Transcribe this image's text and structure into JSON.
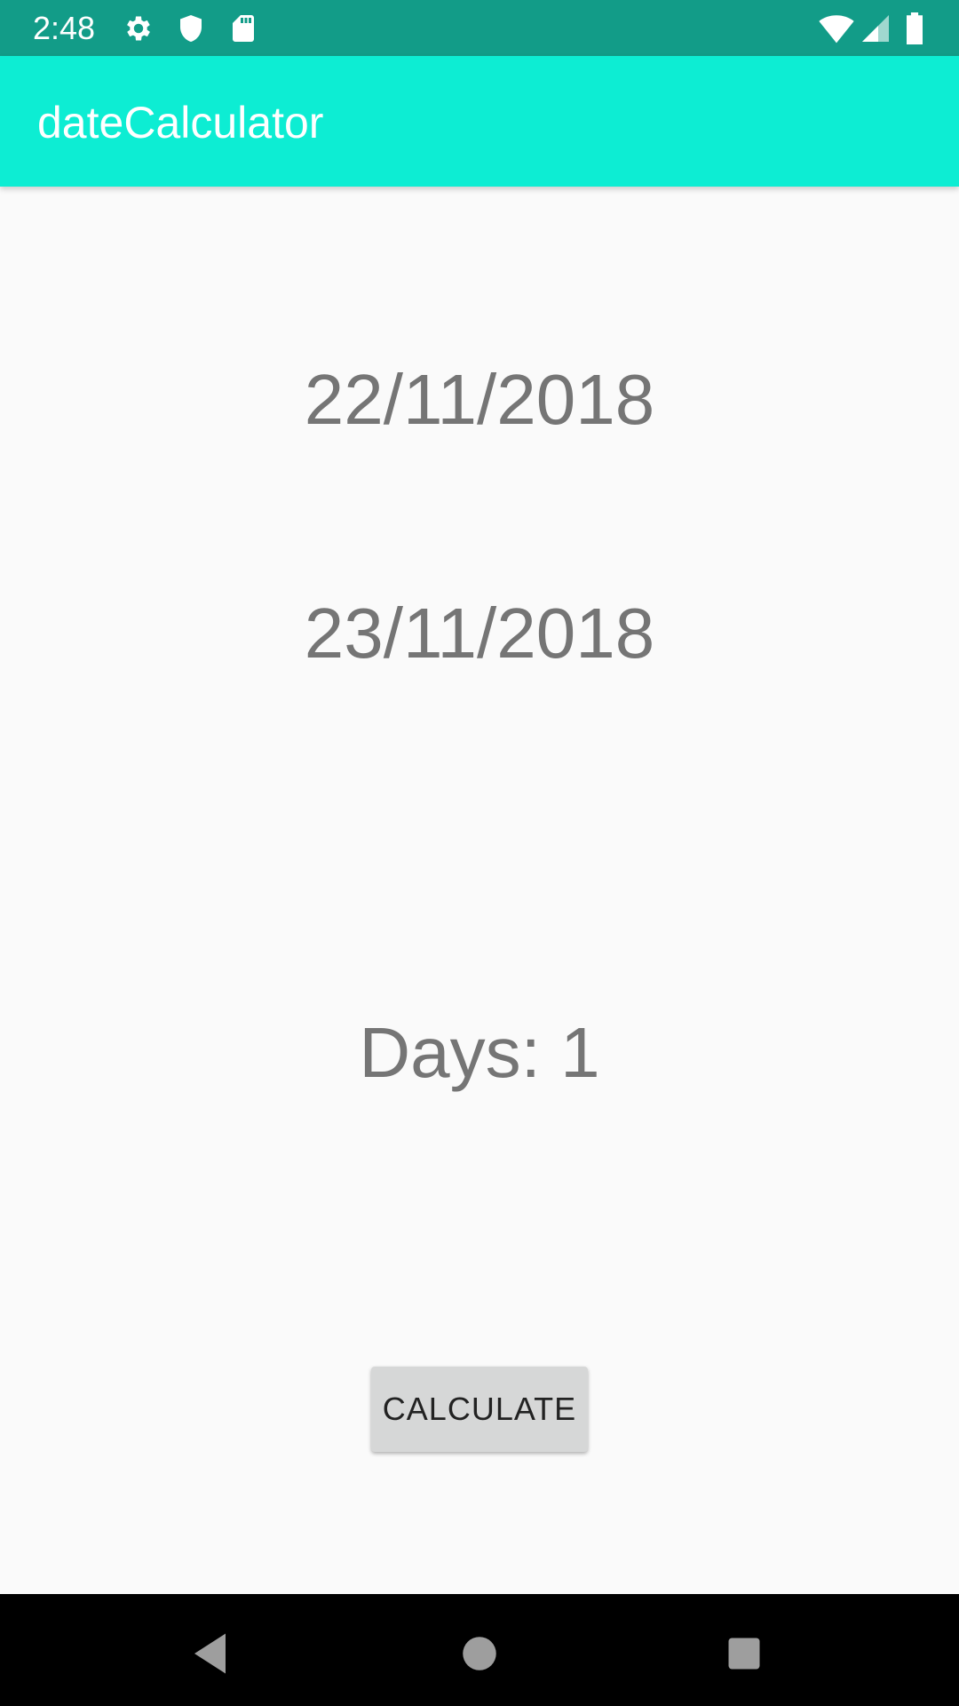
{
  "status_bar": {
    "time": "2:48",
    "icons_left": [
      "settings-icon",
      "shield-icon",
      "sd-card-icon"
    ],
    "icons_right": [
      "wifi-icon",
      "signal-icon",
      "battery-icon"
    ]
  },
  "app_bar": {
    "title": "dateCalculator"
  },
  "main": {
    "start_date": "22/11/2018",
    "end_date": "23/11/2018",
    "result": "Days: 1",
    "calculate_label": "CALCULATE"
  },
  "nav_bar": {
    "buttons": [
      "back-icon",
      "home-icon",
      "recents-icon"
    ]
  },
  "colors": {
    "status_bar": "#129c88",
    "app_bar": "#0dedd3",
    "background": "#fafafa",
    "text": "#757575",
    "button": "#d6d7d7"
  }
}
